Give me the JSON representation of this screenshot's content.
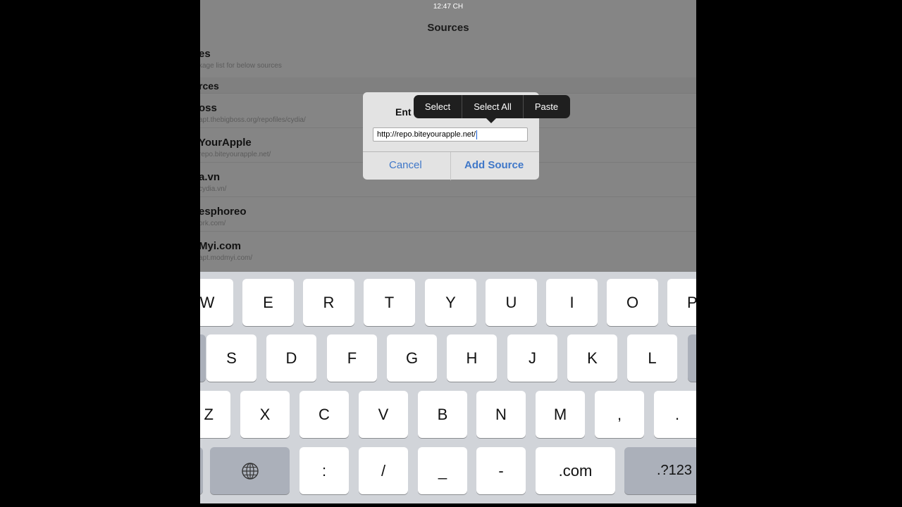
{
  "status_bar": {
    "time": "12:47 CH"
  },
  "nav": {
    "title": "Sources"
  },
  "list": {
    "top_row": {
      "name": "es",
      "subtitle": "kage list for below sources"
    },
    "section_header": "rces",
    "rows": [
      {
        "name": "oss",
        "subtitle": "apt.thebigboss.org/repofiles/cydia/"
      },
      {
        "name": "YourApple",
        "subtitle": "repo.biteyourapple.net/"
      },
      {
        "name": "a.vn",
        "subtitle": "cydia.vn/"
      },
      {
        "name": "esphoreo",
        "subtitle": "ork.com/"
      },
      {
        "name": "Myi.com",
        "subtitle": "apt.modmyi.com/"
      }
    ]
  },
  "dialog": {
    "title": "Ent",
    "input_value": "http://repo.biteyourapple.net/",
    "cancel_label": "Cancel",
    "add_label": "Add Source"
  },
  "edit_menu": {
    "select": "Select",
    "select_all": "Select All",
    "paste": "Paste"
  },
  "keyboard": {
    "row1": [
      "W",
      "E",
      "R",
      "T",
      "Y",
      "U",
      "I",
      "O",
      "P"
    ],
    "row2": [
      "S",
      "D",
      "F",
      "G",
      "H",
      "J",
      "K",
      "L"
    ],
    "row3": [
      "Z",
      "X",
      "C",
      "V",
      "B",
      "N",
      "M",
      ",",
      "."
    ],
    "row4": {
      "globe_icon": "globe-icon",
      "colon": ":",
      "slash": "/",
      "underscore": "_",
      "dash": "-",
      "dotcom": ".com",
      "numbers": ".?123"
    }
  }
}
